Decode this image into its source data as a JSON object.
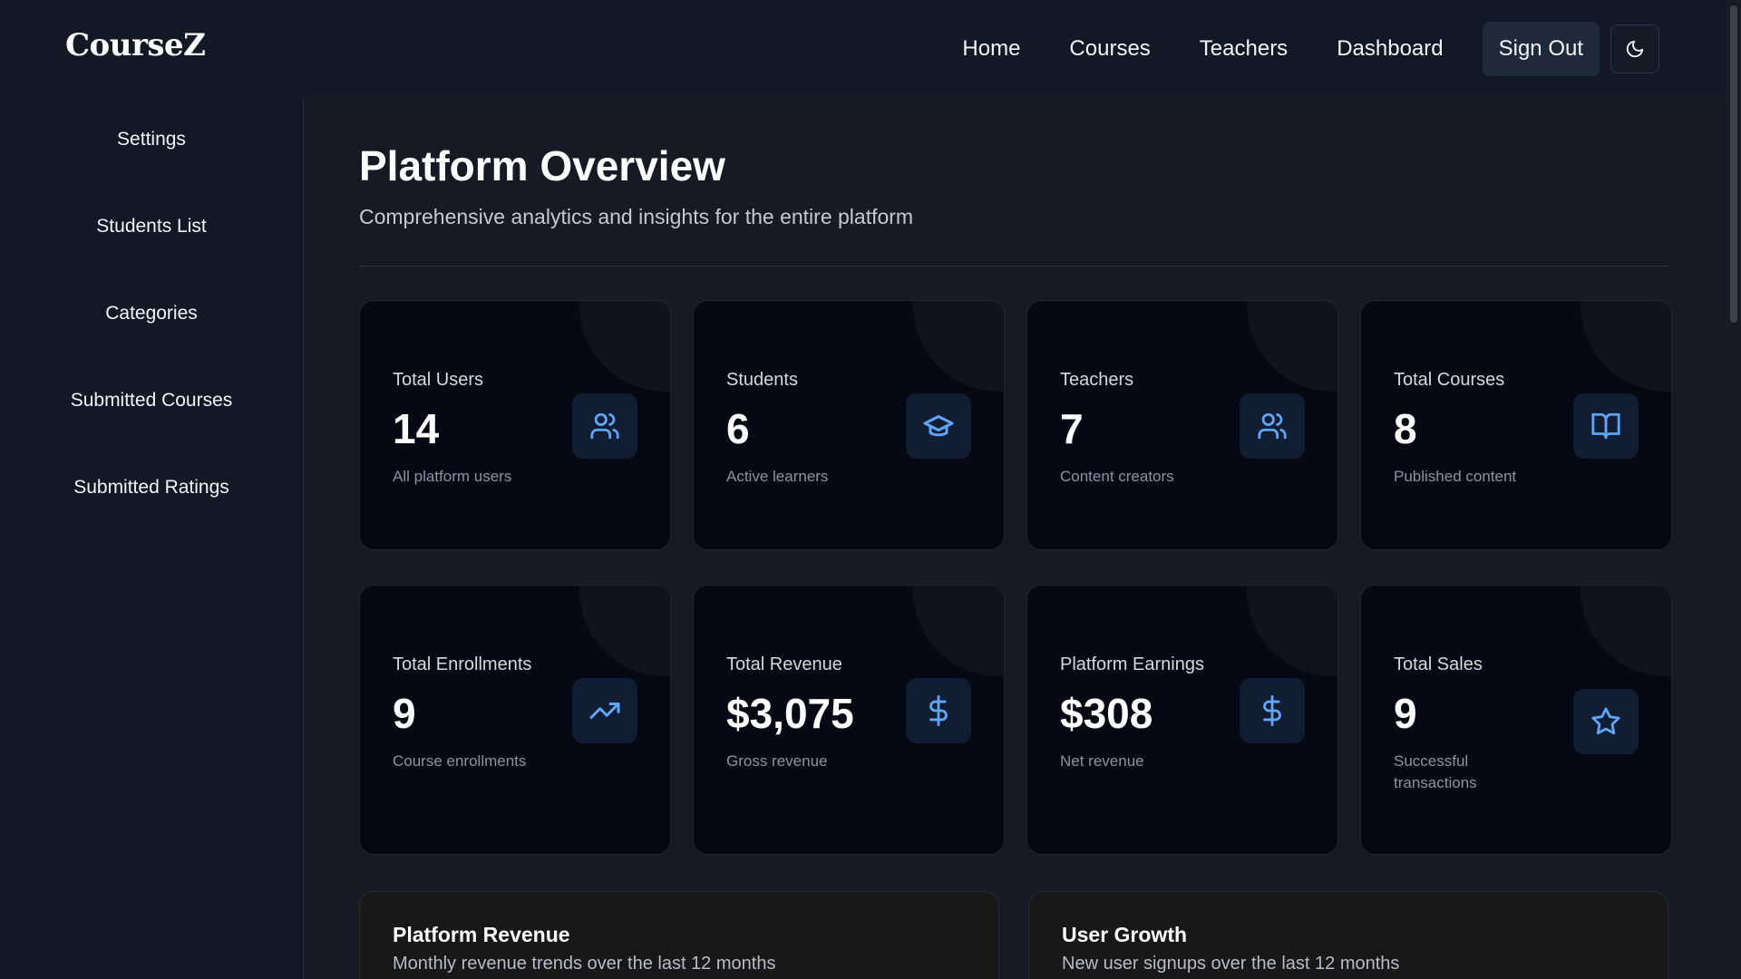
{
  "app": {
    "logo": "CourseZ"
  },
  "header": {
    "nav": [
      "Home",
      "Courses",
      "Teachers",
      "Dashboard"
    ],
    "sign_out_label": "Sign Out",
    "theme_icon": "moon-icon"
  },
  "sidebar": {
    "items": [
      {
        "label": "Settings"
      },
      {
        "label": "Students List"
      },
      {
        "label": "Categories"
      },
      {
        "label": "Submitted Courses"
      },
      {
        "label": "Submitted Ratings"
      }
    ]
  },
  "main": {
    "title": "Platform Overview",
    "subtitle": "Comprehensive analytics and insights for the entire platform"
  },
  "stats": [
    {
      "label": "Total Users",
      "value": "14",
      "desc": "All platform users",
      "icon": "users-icon"
    },
    {
      "label": "Students",
      "value": "6",
      "desc": "Active learners",
      "icon": "graduation-cap-icon"
    },
    {
      "label": "Teachers",
      "value": "7",
      "desc": "Content creators",
      "icon": "users-icon"
    },
    {
      "label": "Total Courses",
      "value": "8",
      "desc": "Published content",
      "icon": "book-open-icon"
    },
    {
      "label": "Total Enrollments",
      "value": "9",
      "desc": "Course enrollments",
      "icon": "trending-up-icon"
    },
    {
      "label": "Total Revenue",
      "value": "$3,075",
      "desc": "Gross revenue",
      "icon": "dollar-icon"
    },
    {
      "label": "Platform Earnings",
      "value": "$308",
      "desc": "Net revenue",
      "icon": "dollar-icon"
    },
    {
      "label": "Total Sales",
      "value": "9",
      "desc": "Successful transactions",
      "icon": "star-icon"
    }
  ],
  "panels": [
    {
      "title": "Platform Revenue",
      "subtitle": "Monthly revenue trends over the last 12 months"
    },
    {
      "title": "User Growth",
      "subtitle": "New user signups over the last 12 months"
    }
  ],
  "colors": {
    "accent": "#3b82f6",
    "icon": "#60a5fa",
    "background": "#161a24",
    "card": "#060913"
  }
}
